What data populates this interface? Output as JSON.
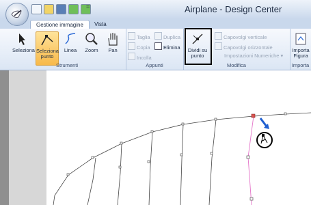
{
  "window": {
    "title": "Airplane - Design Center"
  },
  "quick_access": {
    "dropdown": "="
  },
  "tabs": [
    {
      "label": "Gestione immagine"
    },
    {
      "label": "Vista"
    }
  ],
  "groups": {
    "strumenti": {
      "label": "Strumenti",
      "buttons": [
        {
          "label": "Seleziona"
        },
        {
          "label": "Seleziona punto"
        },
        {
          "label": "Linea"
        },
        {
          "label": "Zoom"
        },
        {
          "label": "Pan"
        }
      ]
    },
    "appunti": {
      "label": "Appunti",
      "items": {
        "taglia": "Taglia",
        "copia": "Copia",
        "incolla": "Incolla",
        "duplica": "Duplica",
        "elimina": "Elimina"
      }
    },
    "modifica": {
      "label": "Modifica",
      "divide_button": "Dividi su punto",
      "capovolgi_verticale": "Capovolgi verticale",
      "capovolgi_orizzontale": "Capovolgi orizzontale",
      "impostazioni": "Impostazioni Numeriche"
    },
    "importa": {
      "label": "Importa",
      "button": "Importa Figura"
    }
  },
  "colors": {
    "ribbon_bg": "#dbe6f4",
    "selected_button": "#f7b94a",
    "accent_arrow": "#1f5fd0",
    "guide_line": "#e472c8"
  }
}
